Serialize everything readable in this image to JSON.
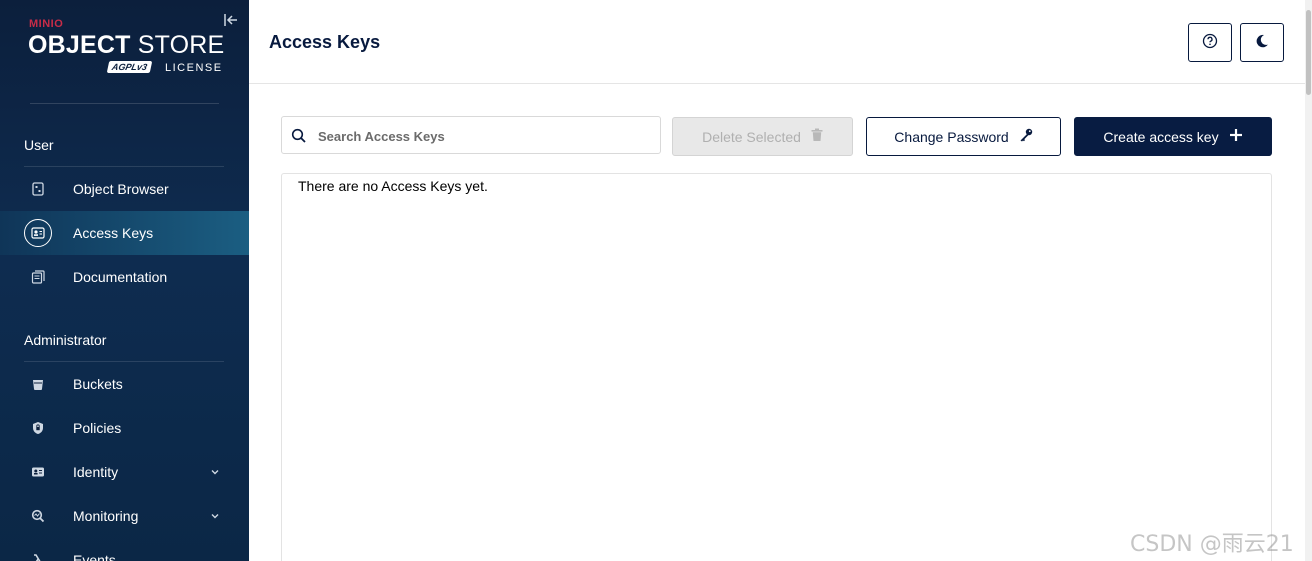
{
  "brand": {
    "minio": "MINIO",
    "title_bold": "OBJECT",
    "title_regular": "STORE",
    "badge": "AGPLv3",
    "license": "LICENSE"
  },
  "sidebar": {
    "sections": [
      {
        "title": "User",
        "items": [
          {
            "label": "Object Browser",
            "icon": "object-browser-icon",
            "active": false
          },
          {
            "label": "Access Keys",
            "icon": "access-keys-icon",
            "active": true
          },
          {
            "label": "Documentation",
            "icon": "documentation-icon",
            "active": false
          }
        ]
      },
      {
        "title": "Administrator",
        "items": [
          {
            "label": "Buckets",
            "icon": "bucket-icon",
            "active": false
          },
          {
            "label": "Policies",
            "icon": "policy-icon",
            "active": false
          },
          {
            "label": "Identity",
            "icon": "identity-icon",
            "active": false,
            "expandable": true
          },
          {
            "label": "Monitoring",
            "icon": "monitoring-icon",
            "active": false,
            "expandable": true
          },
          {
            "label": "Events",
            "icon": "lambda-icon",
            "active": false
          }
        ]
      }
    ]
  },
  "header": {
    "title": "Access Keys",
    "help_icon": "help-icon",
    "theme_icon": "moon-icon"
  },
  "toolbar": {
    "search_placeholder": "Search Access Keys",
    "delete_label": "Delete Selected",
    "change_password_label": "Change Password",
    "create_label": "Create access key"
  },
  "content": {
    "empty_message": "There are no Access Keys yet."
  },
  "watermark": "CSDN @雨云21",
  "colors": {
    "sidebar_bg": "#0c1f3c",
    "active_item_bg": "#1b5e82",
    "primary": "#081c42",
    "brand_red": "#c72c48",
    "disabled_bg": "#e8e8e8"
  }
}
